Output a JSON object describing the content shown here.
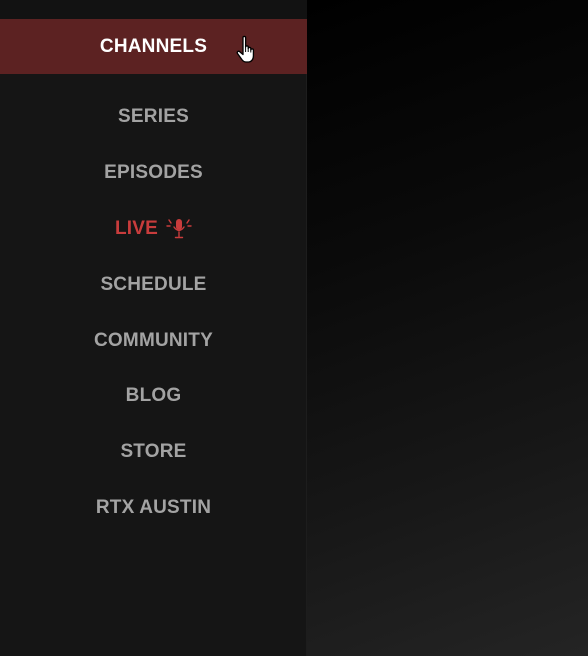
{
  "nav": {
    "items": [
      {
        "label": "CHANNELS"
      },
      {
        "label": "SERIES"
      },
      {
        "label": "EPISODES"
      },
      {
        "label": "LIVE",
        "icon": "microphone-icon"
      },
      {
        "label": "SCHEDULE"
      },
      {
        "label": "COMMUNITY"
      },
      {
        "label": "BLOG"
      },
      {
        "label": "STORE"
      },
      {
        "label": "RTX AUSTIN"
      }
    ]
  },
  "colors": {
    "sidebar_bg": "#151515",
    "active_bg": "#5c2222",
    "active_text": "#ffffff",
    "item_text": "#a3a3a3",
    "live_text": "#c83c3c"
  },
  "cursor": {
    "icon": "hand-pointer-icon"
  }
}
